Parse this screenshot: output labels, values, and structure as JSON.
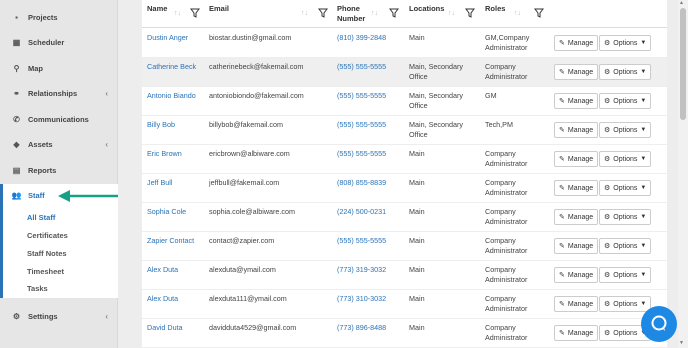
{
  "sidebar": {
    "items": [
      {
        "label": "Projects",
        "icon": "briefcase-icon",
        "glyph": "▪"
      },
      {
        "label": "Scheduler",
        "icon": "calendar-icon",
        "glyph": "▦"
      },
      {
        "label": "Map",
        "icon": "map-marker-icon",
        "glyph": "⚲"
      },
      {
        "label": "Relationships",
        "icon": "handshake-icon",
        "glyph": "⚭",
        "caret": "‹"
      },
      {
        "label": "Communications",
        "icon": "phone-icon",
        "glyph": "✆"
      },
      {
        "label": "Assets",
        "icon": "tag-icon",
        "glyph": "◆",
        "caret": "‹"
      },
      {
        "label": "Reports",
        "icon": "report-icon",
        "glyph": "▤"
      },
      {
        "label": "Staff",
        "icon": "users-icon",
        "glyph": "👥"
      },
      {
        "label": "Settings",
        "icon": "cogs-icon",
        "glyph": "⚙",
        "caret": "‹"
      }
    ],
    "sub_items": [
      "All Staff",
      "Certificates",
      "Staff Notes",
      "Timesheet",
      "Tasks"
    ]
  },
  "table": {
    "headers": {
      "name": "Name",
      "email": "Email",
      "phone_line1": "Phone",
      "phone_line2": "Number",
      "locations": "Locations",
      "roles": "Roles"
    },
    "sort_glyph": "↑↓",
    "manage_label": "Manage",
    "options_label": "Options",
    "rows": [
      {
        "name": "Dustin Anger",
        "email": "biostar.dustin@gmail.com",
        "phone": "(810) 399-2848",
        "loc1": "Main",
        "loc2": "",
        "role1": "GM,Company",
        "role2": "Administrator"
      },
      {
        "name": "Catherine Beck",
        "email": "catherinebeck@fakemail.com",
        "phone": "(555) 555-5555",
        "loc1": "Main, Secondary",
        "loc2": "Office",
        "role1": "Company",
        "role2": "Administrator"
      },
      {
        "name": "Antonio Biando",
        "email": "antoniobiondo@fakemail.com",
        "phone": "(555) 555-5555",
        "loc1": "Main, Secondary",
        "loc2": "Office",
        "role1": "GM",
        "role2": ""
      },
      {
        "name": "Billy Bob",
        "email": "billybob@fakemail.com",
        "phone": "(555) 555-5555",
        "loc1": "Main, Secondary",
        "loc2": "Office",
        "role1": "Tech,PM",
        "role2": ""
      },
      {
        "name": "Eric Brown",
        "email": "ericbrown@albiware.com",
        "phone": "(555) 555-5555",
        "loc1": "Main",
        "loc2": "",
        "role1": "Company",
        "role2": "Administrator"
      },
      {
        "name": "Jeff Bull",
        "email": "jeffbull@fakemail.com",
        "phone": "(808) 855-8839",
        "loc1": "Main",
        "loc2": "",
        "role1": "Company",
        "role2": "Administrator"
      },
      {
        "name": "Sophia Cole",
        "email": "sophia.cole@albiware.com",
        "phone": "(224) 500-0231",
        "loc1": "Main",
        "loc2": "",
        "role1": "Company",
        "role2": "Administrator"
      },
      {
        "name": "Zapier Contact",
        "email": "contact@zapier.com",
        "phone": "(555) 555-5555",
        "loc1": "Main",
        "loc2": "",
        "role1": "Company",
        "role2": "Administrator"
      },
      {
        "name": "Alex Duta",
        "email": "alexduta@ymail.com",
        "phone": "(773) 319-3032",
        "loc1": "Main",
        "loc2": "",
        "role1": "Company",
        "role2": "Administrator"
      },
      {
        "name": "Alex Duta",
        "email": "alexduta111@ymail.com",
        "phone": "(773) 310-3032",
        "loc1": "Main",
        "loc2": "",
        "role1": "Company",
        "role2": "Administrator"
      },
      {
        "name": "David Duta",
        "email": "davidduta4529@gmail.com",
        "phone": "(773) 896-8488",
        "loc1": "Main",
        "loc2": "",
        "role1": "Company",
        "role2": "Administrator"
      }
    ]
  },
  "colors": {
    "accent": "#2a73b7",
    "arrow": "#16a085",
    "chat": "#1e88e5"
  }
}
